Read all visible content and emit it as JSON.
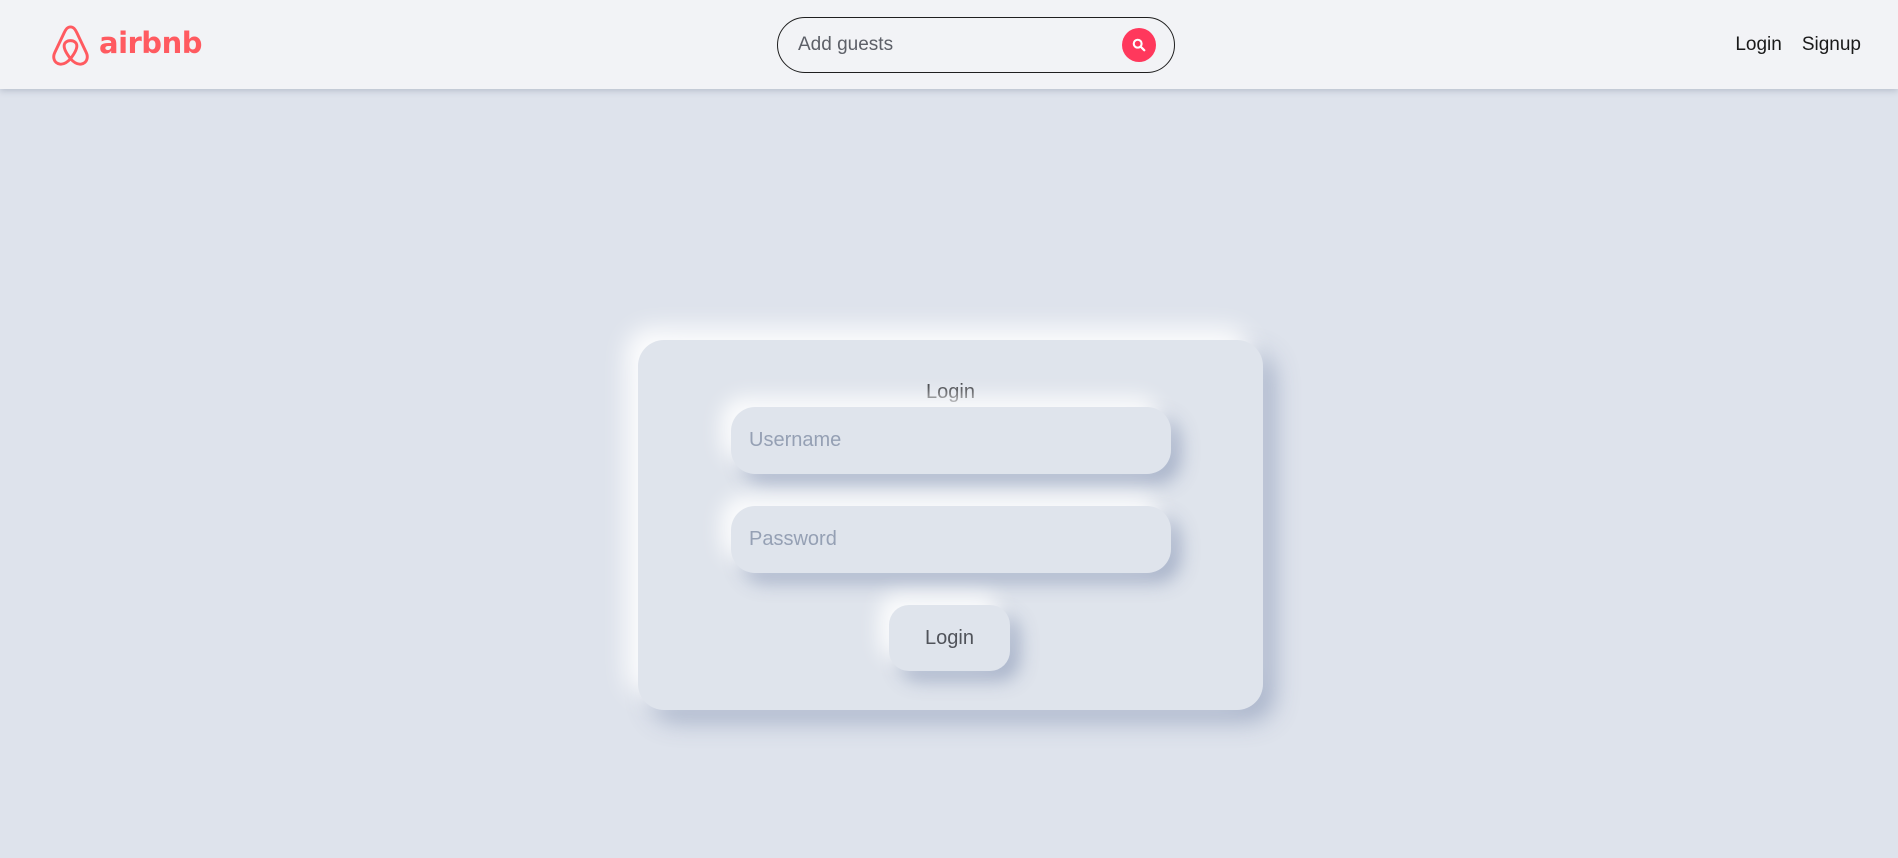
{
  "header": {
    "brand_name": "airbnb",
    "logo_icon": "airbnb-belo-icon",
    "brand_color": "#ff5a60",
    "search": {
      "placeholder": "Add guests",
      "value": "",
      "button_icon": "search-icon",
      "button_color": "#ff385c"
    },
    "nav": {
      "login_label": "Login",
      "signup_label": "Signup"
    }
  },
  "login_form": {
    "title": "Login",
    "username_placeholder": "Username",
    "username_value": "",
    "password_placeholder": "Password",
    "password_value": "",
    "submit_label": "Login"
  }
}
